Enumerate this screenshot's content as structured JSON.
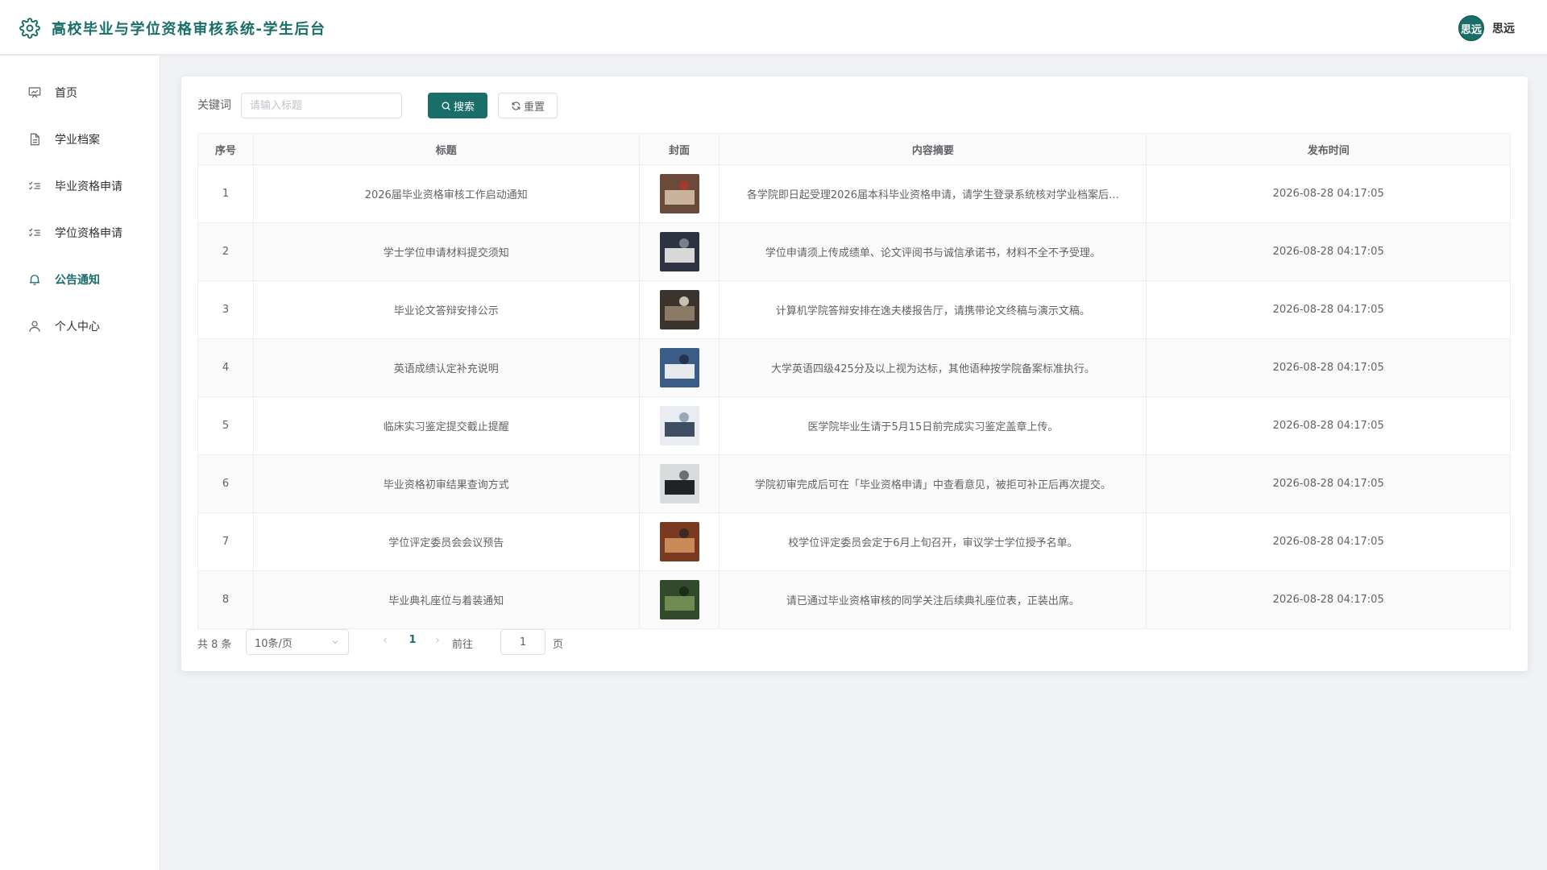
{
  "header": {
    "title": "高校毕业与学位资格审核系统-学生后台",
    "avatar_text": "思远",
    "username": "思远",
    "accent_color": "#1a6e6a"
  },
  "sidebar": {
    "items": [
      {
        "label": "首页",
        "icon": "dashboard-icon",
        "active": false
      },
      {
        "label": "学业档案",
        "icon": "document-icon",
        "active": false
      },
      {
        "label": "毕业资格申请",
        "icon": "checklist-icon",
        "active": false
      },
      {
        "label": "学位资格申请",
        "icon": "checklist-icon",
        "active": false
      },
      {
        "label": "公告通知",
        "icon": "bell-icon",
        "active": true
      },
      {
        "label": "个人中心",
        "icon": "user-icon",
        "active": false
      }
    ]
  },
  "filter": {
    "label": "关键词",
    "placeholder": "请输入标题",
    "value": "",
    "search_label": "搜索",
    "reset_label": "重置"
  },
  "table": {
    "columns": [
      "序号",
      "标题",
      "封面",
      "内容摘要",
      "发布时间"
    ],
    "rows": [
      {
        "idx": "1",
        "title": "2026届毕业资格审核工作启动通知",
        "summary": "各学院即日起受理2026届本科毕业资格申请，请学生登录系统核对学业档案后…",
        "time": "2026-08-28 04:17:05"
      },
      {
        "idx": "2",
        "title": "学士学位申请材料提交须知",
        "summary": "学位申请须上传成绩单、论文评阅书与诚信承诺书，材料不全不予受理。",
        "time": "2026-08-28 04:17:05"
      },
      {
        "idx": "3",
        "title": "毕业论文答辩安排公示",
        "summary": "计算机学院答辩安排在逸夫楼报告厅，请携带论文终稿与演示文稿。",
        "time": "2026-08-28 04:17:05"
      },
      {
        "idx": "4",
        "title": "英语成绩认定补充说明",
        "summary": "大学英语四级425分及以上视为达标，其他语种按学院备案标准执行。",
        "time": "2026-08-28 04:17:05"
      },
      {
        "idx": "5",
        "title": "临床实习鉴定提交截止提醒",
        "summary": "医学院毕业生请于5月15日前完成实习鉴定盖章上传。",
        "time": "2026-08-28 04:17:05"
      },
      {
        "idx": "6",
        "title": "毕业资格初审结果查询方式",
        "summary": "学院初审完成后可在「毕业资格申请」中查看意见，被拒可补正后再次提交。",
        "time": "2026-08-28 04:17:05"
      },
      {
        "idx": "7",
        "title": "学位评定委员会会议预告",
        "summary": "校学位评定委员会定于6月上旬召开，审议学士学位授予名单。",
        "time": "2026-08-28 04:17:05"
      },
      {
        "idx": "8",
        "title": "毕业典礼座位与着装通知",
        "summary": "请已通过毕业资格审核的同学关注后续典礼座位表，正装出席。",
        "time": "2026-08-28 04:17:05"
      }
    ]
  },
  "pagination": {
    "total_text": "共 8 条",
    "page_size": "10条/页",
    "current_page": "1",
    "goto_label": "前往",
    "goto_value": "1",
    "page_suffix": "页"
  }
}
